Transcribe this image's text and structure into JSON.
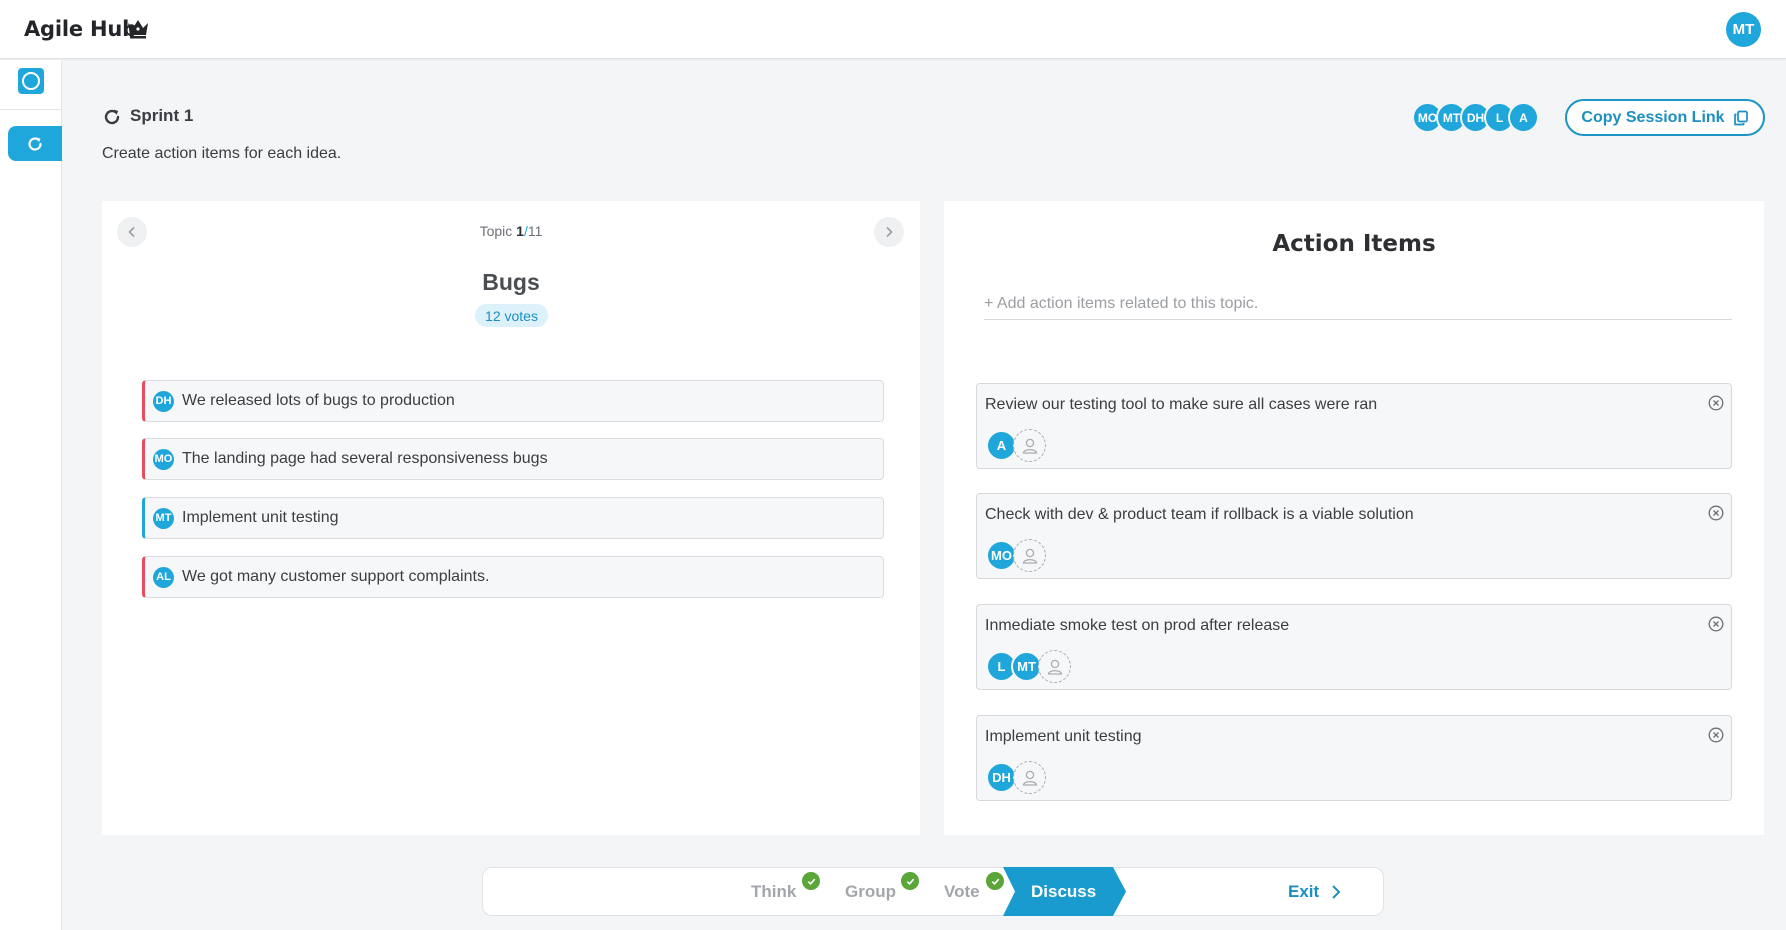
{
  "app": {
    "title": "Agile Hub",
    "user_initials": "MT"
  },
  "session": {
    "name": "Sprint 1",
    "instruction": "Create action items for each idea.",
    "participants": [
      "MO",
      "MT",
      "DH",
      "L",
      "A"
    ],
    "copy_link_label": "Copy Session Link"
  },
  "topic": {
    "label": "Topic",
    "current": "1",
    "separator": "/",
    "total": "11",
    "name": "Bugs",
    "votes": "12 votes",
    "ideas": [
      {
        "author": "DH",
        "text": "We released lots of bugs to production",
        "color": "red"
      },
      {
        "author": "MO",
        "text": "The landing page had several responsiveness bugs",
        "color": "red"
      },
      {
        "author": "MT",
        "text": "Implement unit testing",
        "color": "blue"
      },
      {
        "author": "AL",
        "text": "We got many customer support complaints.",
        "color": "red"
      }
    ]
  },
  "action_items": {
    "title": "Action Items",
    "input_placeholder": "+ Add action items related to this topic.",
    "items": [
      {
        "text": "Review our testing tool to make sure all cases were ran",
        "assignees": [
          "A"
        ]
      },
      {
        "text": "Check with dev & product team if rollback is a viable solution",
        "assignees": [
          "MO"
        ]
      },
      {
        "text": "Inmediate smoke test on prod after release",
        "assignees": [
          "L",
          "MT"
        ]
      },
      {
        "text": "Implement unit testing",
        "assignees": [
          "DH"
        ]
      }
    ]
  },
  "stepper": {
    "steps": [
      {
        "label": "Think",
        "status": "done"
      },
      {
        "label": "Group",
        "status": "done"
      },
      {
        "label": "Vote",
        "status": "done"
      },
      {
        "label": "Discuss",
        "status": "active"
      }
    ],
    "exit_label": "Exit"
  },
  "colors": {
    "accent": "#1fa6db",
    "accent_dark": "#1c8fc0",
    "done_green": "#5aa638",
    "idea_red": "#e84a5f",
    "badge_bg": "#dcf1fa"
  }
}
